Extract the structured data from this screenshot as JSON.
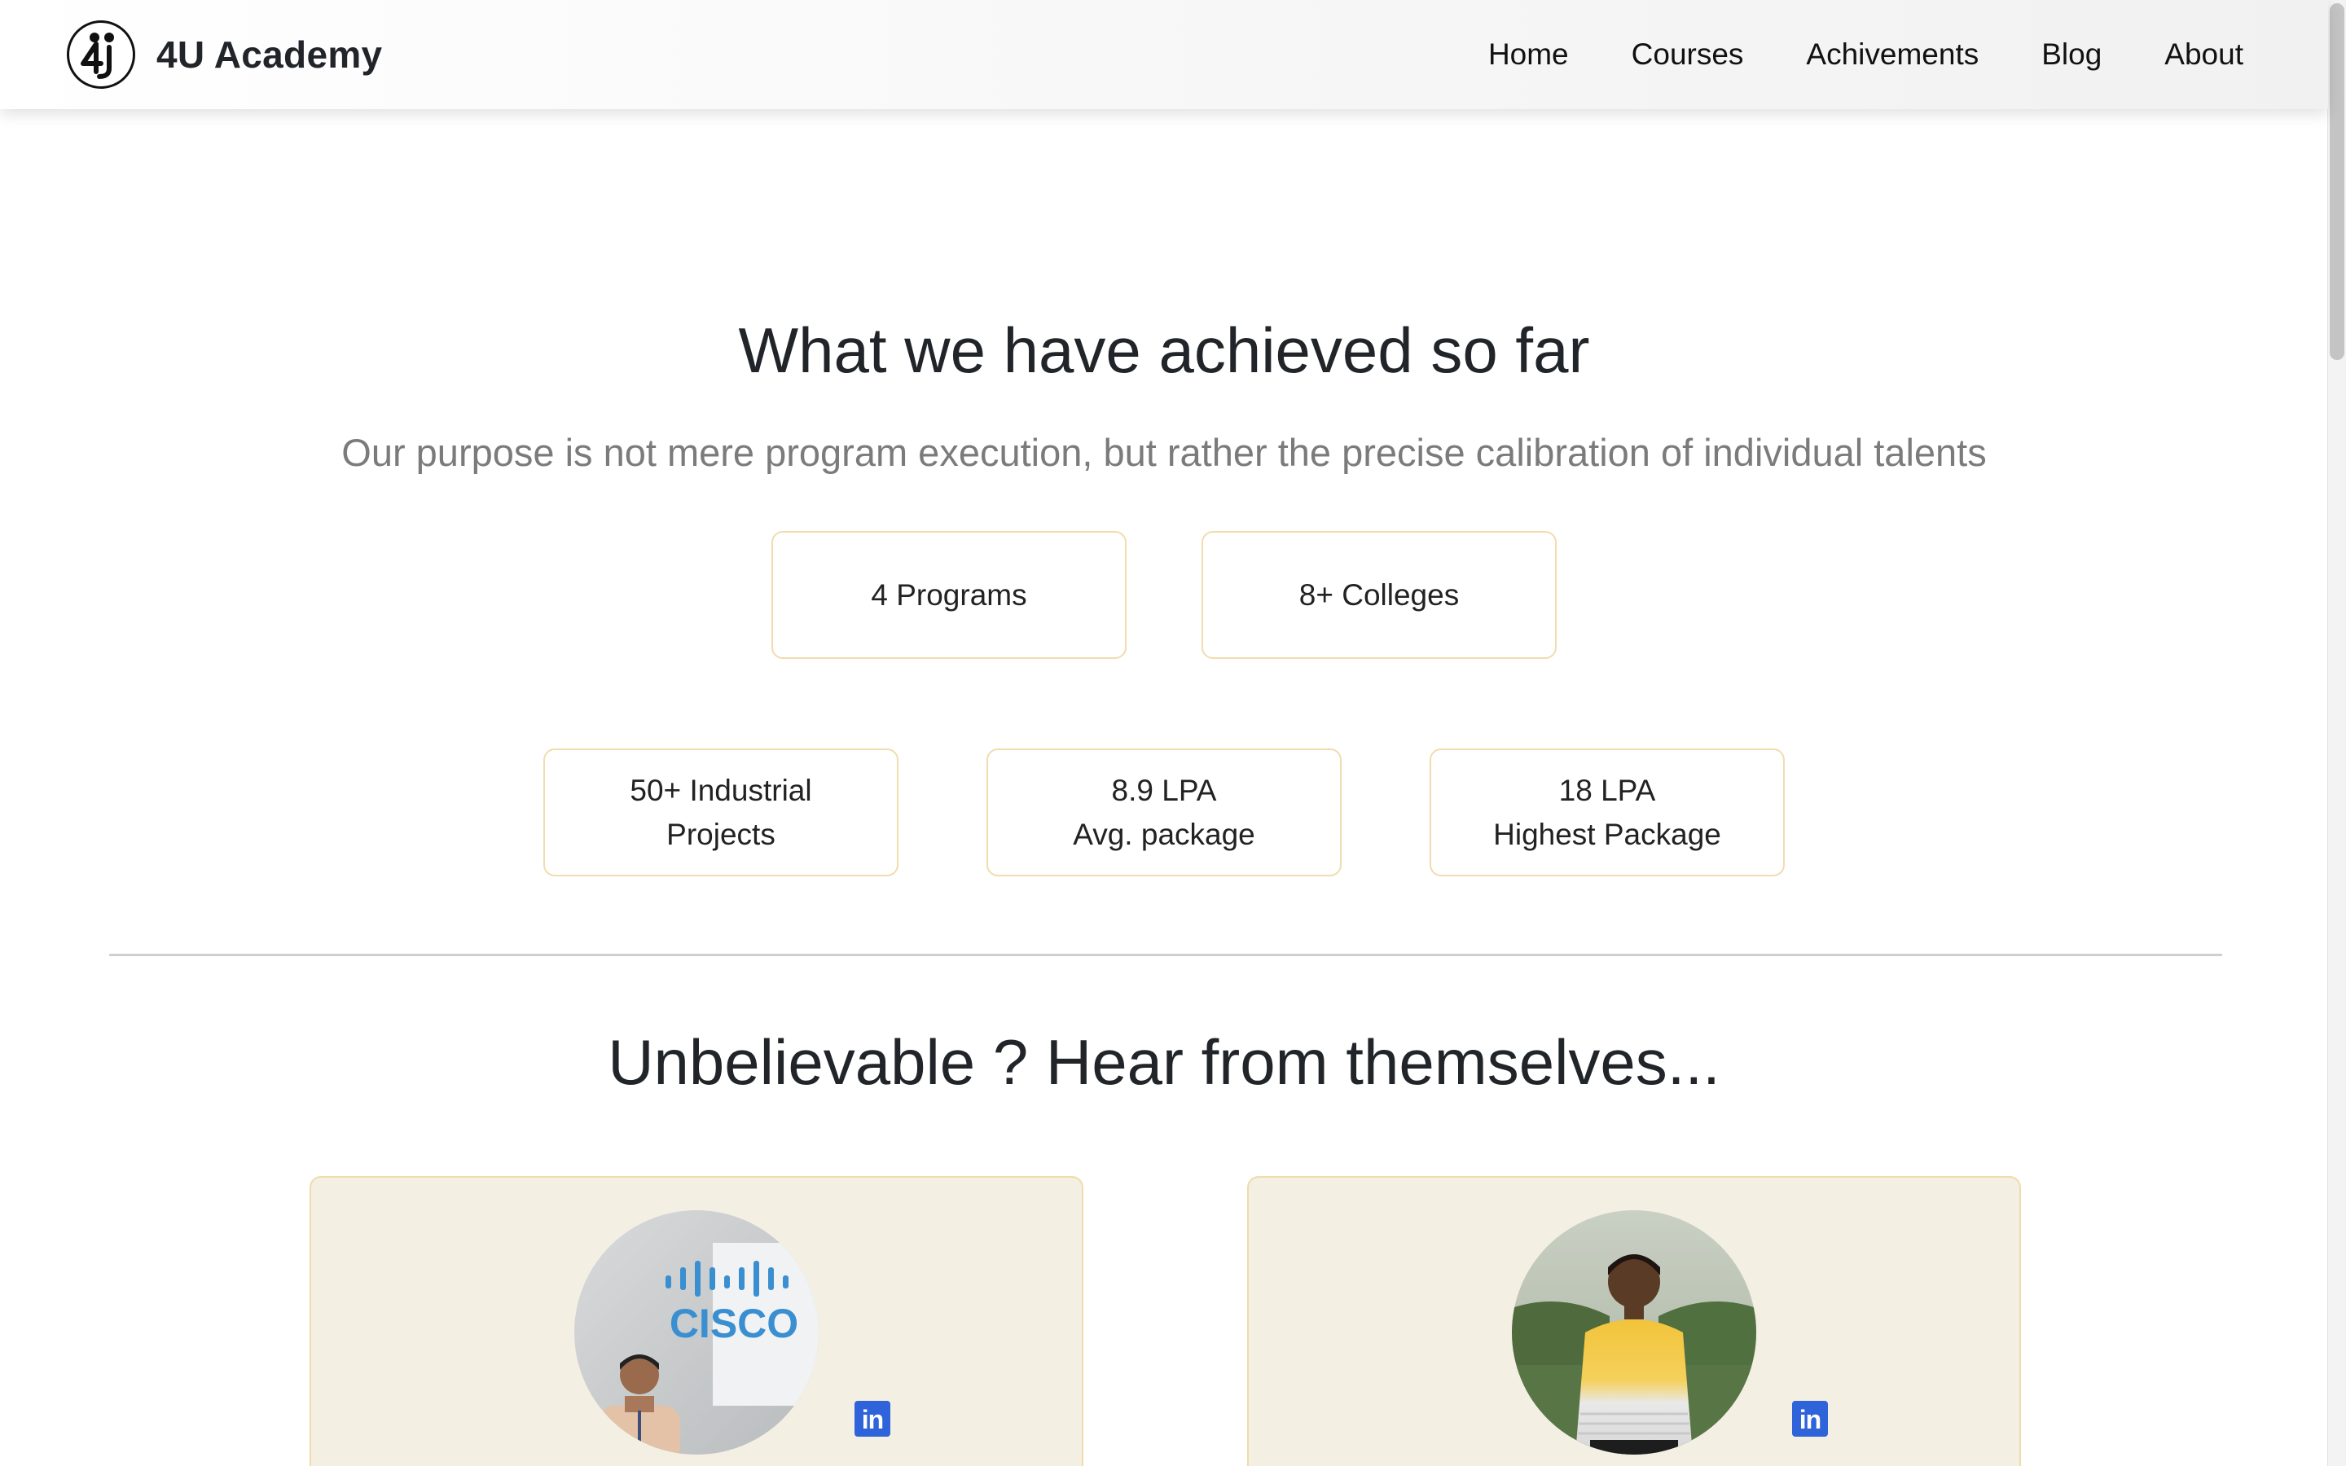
{
  "navbar": {
    "brand_name": "4U Academy",
    "logo_text": "4U",
    "links": [
      "Home",
      "Courses",
      "Achivements",
      "Blog",
      "About"
    ]
  },
  "achievements": {
    "title": "What we have achieved so far",
    "subtitle": "Our purpose is not mere program execution, but rather the precise calibration of individual talents",
    "stats_row1": [
      {
        "line1": "4 Programs",
        "line2": ""
      },
      {
        "line1": "8+ Colleges",
        "line2": ""
      }
    ],
    "stats_row2": [
      {
        "line1": "50+ Industrial",
        "line2": "Projects"
      },
      {
        "line1": "8.9 LPA",
        "line2": "Avg. package"
      },
      {
        "line1": "18 LPA",
        "line2": "Highest Package"
      }
    ]
  },
  "testimonials": {
    "title": "Unbelievable ? Hear from themselves...",
    "cards": [
      {
        "avatar_caption": "CISCO",
        "linkedin_icon": "in"
      },
      {
        "avatar_caption": "",
        "linkedin_icon": "in"
      }
    ]
  },
  "colors": {
    "card_border": "#f1dcae",
    "testimonial_bg": "#f3efe3",
    "linkedin_blue": "#2f63d9",
    "subtitle_gray": "#7b7b7b"
  }
}
